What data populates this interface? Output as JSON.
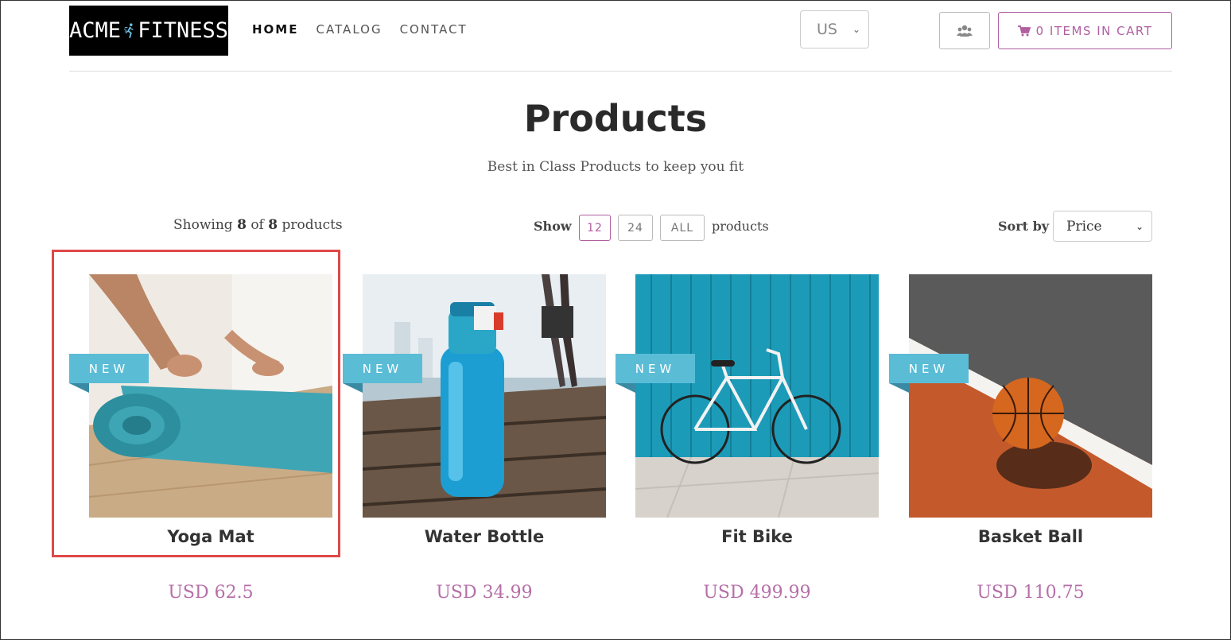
{
  "header": {
    "logo_text_left": "ACME",
    "logo_text_right": "FITNESS",
    "nav": [
      {
        "label": "HOME",
        "active": true
      },
      {
        "label": "CATALOG",
        "active": false
      },
      {
        "label": "CONTACT",
        "active": false
      }
    ],
    "region": "US",
    "cart_label": "0 ITEMS IN CART",
    "brand_color": "#b05fa0"
  },
  "page": {
    "title": "Products",
    "subtitle": "Best in Class Products to keep you fit"
  },
  "controls": {
    "showing_prefix": "Showing",
    "showing_count": "8",
    "showing_of": "of",
    "showing_total": "8",
    "showing_suffix": "products",
    "show_label": "Show",
    "page_sizes": [
      "12",
      "24",
      "ALL"
    ],
    "products_label": "products",
    "sort_label": "Sort by",
    "sort_value": "Price"
  },
  "products": [
    {
      "name": "Yoga Mat",
      "price": "USD 62.5",
      "badge": "NEW",
      "icon": "yoga-mat-image"
    },
    {
      "name": "Water Bottle",
      "price": "USD 34.99",
      "badge": "NEW",
      "icon": "water-bottle-image"
    },
    {
      "name": "Fit Bike",
      "price": "USD 499.99",
      "badge": "NEW",
      "icon": "bike-image"
    },
    {
      "name": "Basket Ball",
      "price": "USD 110.75",
      "badge": "NEW",
      "icon": "basketball-image"
    }
  ]
}
